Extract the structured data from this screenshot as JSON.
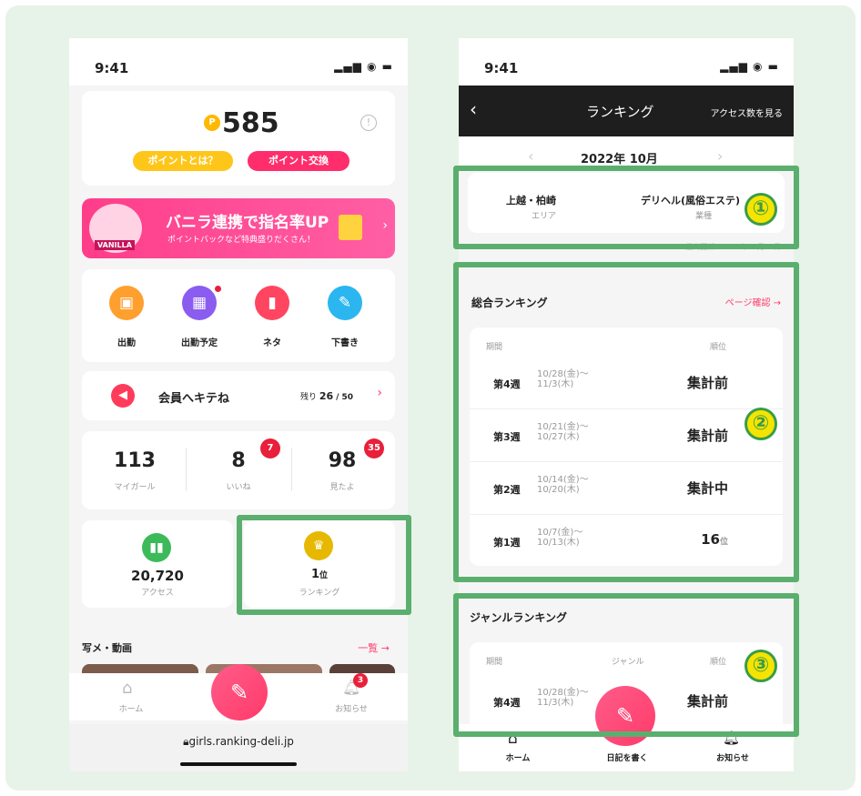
{
  "left": {
    "status_time": "9:41",
    "points": "585",
    "point_about": "ポイントとは？",
    "point_exchange": "ポイント交換",
    "banner_title": "バニラ連携で指名率UP",
    "banner_sub": "ポイントバックなど特典盛りだくさん！",
    "banner_logo": "VANILLA",
    "actions": [
      {
        "label": "出勤",
        "icon": "bag-icon"
      },
      {
        "label": "出勤予定",
        "icon": "calendar-icon"
      },
      {
        "label": "ネタ",
        "icon": "notebook-icon"
      },
      {
        "label": "下書き",
        "icon": "edit-note-icon"
      }
    ],
    "kitene_label": "会員へキテね",
    "kitene_prefix": "残り",
    "kitene_count": "26",
    "kitene_total": "/ 50",
    "stats": [
      {
        "value": "113",
        "label": "マイガール"
      },
      {
        "value": "8",
        "label": "いいね",
        "badge": "7"
      },
      {
        "value": "98",
        "label": "見たよ",
        "badge": "35"
      }
    ],
    "access_value": "20,720",
    "access_label": "アクセス",
    "ranking_value": "1",
    "ranking_unit": "位",
    "ranking_label": "ランキング",
    "photo_title": "写メ・動画",
    "photo_more": "一覧 →",
    "nav_home": "ホーム",
    "nav_notice": "お知らせ",
    "notice_badge": "3",
    "url": "girls.ranking-deli.jp"
  },
  "right": {
    "status_time": "9:41",
    "header_title": "ランキング",
    "header_action": "アクセス数を見る",
    "month": "2022年 10月",
    "area_value": "上越・柏崎",
    "area_label": "エリア",
    "genre_value": "デリヘル(風俗エステ)",
    "genre_label": "業種",
    "updated": "最終更新：2022年10月11日",
    "overall_title": "総合ランキング",
    "overall_link": "ページ確認 →",
    "col_period": "期間",
    "col_rank": "順位",
    "col_genre": "ジャンル",
    "rows": [
      {
        "week": "第4週",
        "dates": "10/28(金)〜\n11/3(木)",
        "rank": "集計前"
      },
      {
        "week": "第3週",
        "dates": "10/21(金)〜\n10/27(木)",
        "rank": "集計前"
      },
      {
        "week": "第2週",
        "dates": "10/14(金)〜\n10/20(木)",
        "rank": "集計中"
      },
      {
        "week": "第1週",
        "dates": "10/7(金)〜\n10/13(木)",
        "rank": "16",
        "unit": "位"
      }
    ],
    "genre_title": "ジャンルランキング",
    "genre_row": {
      "week": "第4週",
      "dates": "10/28(金)〜\n11/3(木)",
      "rank": "集計前"
    },
    "nav_home": "ホーム",
    "nav_write": "日記を書く",
    "nav_notice": "お知らせ"
  },
  "markers": [
    "①",
    "②",
    "③"
  ],
  "colors": {
    "accent_green": "#5aaf6e",
    "pink": "#ff3b6a",
    "yellow": "#ffc61a"
  }
}
